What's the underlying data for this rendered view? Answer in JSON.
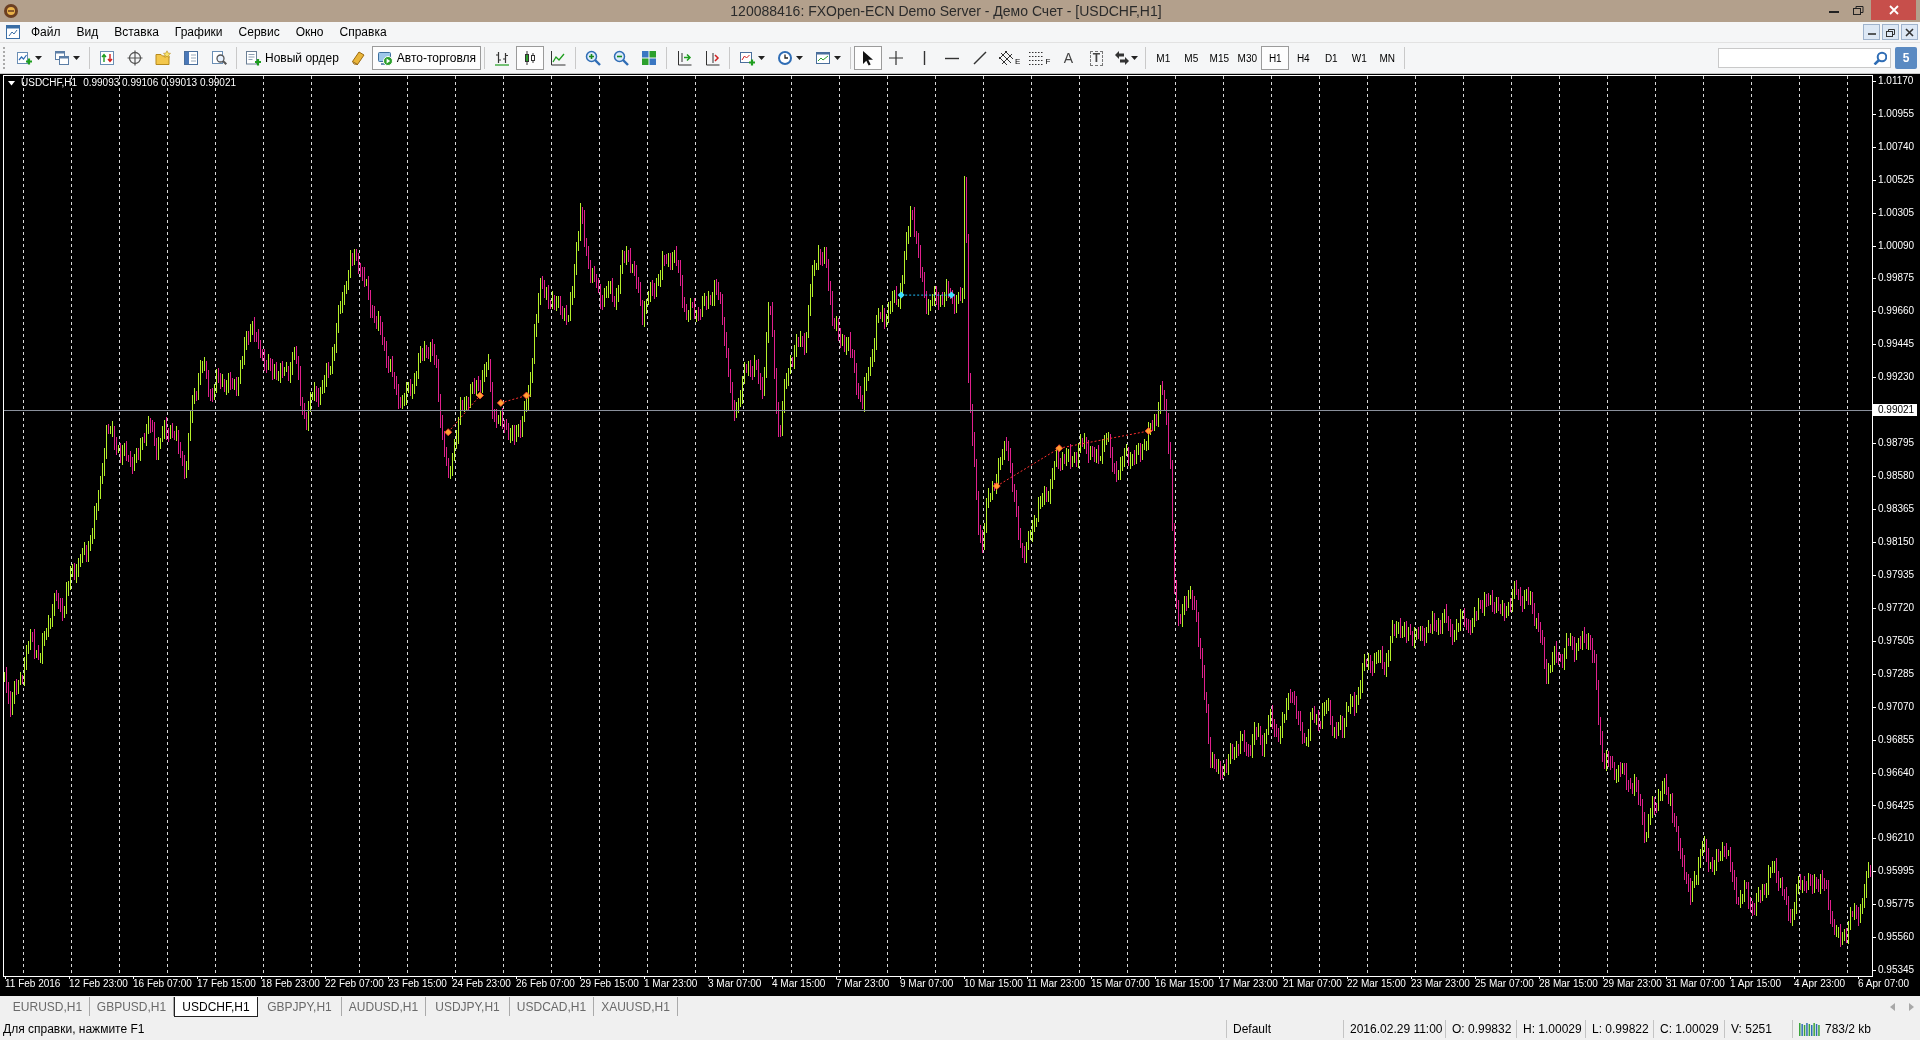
{
  "window": {
    "title": "120088416: FXOpen-ECN Demo Server - Демо Счет - [USDCHF,H1]"
  },
  "menu": [
    "Файл",
    "Вид",
    "Вставка",
    "Графики",
    "Сервис",
    "Окно",
    "Справка"
  ],
  "toolbar": {
    "new_order": "Новый ордер",
    "autotrading": {
      "label": "Авто-торговля",
      "on": true
    },
    "chart_types": [
      {
        "kind": "bars",
        "selected": false
      },
      {
        "kind": "candles",
        "selected": true
      },
      {
        "kind": "line",
        "selected": false
      }
    ],
    "tools": [
      {
        "kind": "cursor",
        "selected": true
      },
      {
        "kind": "crosshair",
        "selected": false
      },
      {
        "kind": "vline",
        "selected": false
      },
      {
        "kind": "hline",
        "selected": false
      },
      {
        "kind": "trendline",
        "selected": false
      },
      {
        "kind": "channel",
        "selected": false,
        "label": "E"
      },
      {
        "kind": "fibo",
        "selected": false,
        "label": "F"
      },
      {
        "kind": "text",
        "selected": false,
        "label": "A"
      },
      {
        "kind": "textlabel",
        "selected": false,
        "label": "T"
      },
      {
        "kind": "arrows",
        "selected": false
      }
    ],
    "timeframes": [
      {
        "label": "M1",
        "selected": false
      },
      {
        "label": "M5",
        "selected": false
      },
      {
        "label": "M15",
        "selected": false
      },
      {
        "label": "M30",
        "selected": false
      },
      {
        "label": "H1",
        "selected": true
      },
      {
        "label": "H4",
        "selected": false
      },
      {
        "label": "D1",
        "selected": false
      },
      {
        "label": "W1",
        "selected": false
      },
      {
        "label": "MN",
        "selected": false
      }
    ],
    "messages": "5"
  },
  "chart": {
    "symbol": "USDCHF,H1",
    "ohlc": "0.99093 0.99106 0.99013 0.99021",
    "price_axis": [
      {
        "kind": "tick",
        "label": "1.01170"
      },
      {
        "kind": "tick",
        "label": "1.00955"
      },
      {
        "kind": "tick",
        "label": "1.00740"
      },
      {
        "kind": "tick",
        "label": "1.00525"
      },
      {
        "kind": "tick",
        "label": "1.00305"
      },
      {
        "kind": "tick",
        "label": "1.00090"
      },
      {
        "kind": "tick",
        "label": "0.99875"
      },
      {
        "kind": "tick",
        "label": "0.99660"
      },
      {
        "kind": "tick",
        "label": "0.99445"
      },
      {
        "kind": "tick",
        "label": "0.99230"
      },
      {
        "kind": "current",
        "label": "0.99021"
      },
      {
        "kind": "tick",
        "label": "0.98795"
      },
      {
        "kind": "tick",
        "label": "0.98580"
      },
      {
        "kind": "tick",
        "label": "0.98365"
      },
      {
        "kind": "tick",
        "label": "0.98150"
      },
      {
        "kind": "tick",
        "label": "0.97935"
      },
      {
        "kind": "tick",
        "label": "0.97720"
      },
      {
        "kind": "tick",
        "label": "0.97505"
      },
      {
        "kind": "tick",
        "label": "0.97285"
      },
      {
        "kind": "tick",
        "label": "0.97070"
      },
      {
        "kind": "tick",
        "label": "0.96855"
      },
      {
        "kind": "tick",
        "label": "0.96640"
      },
      {
        "kind": "tick",
        "label": "0.96425"
      },
      {
        "kind": "tick",
        "label": "0.96210"
      },
      {
        "kind": "tick",
        "label": "0.95995"
      },
      {
        "kind": "tick",
        "label": "0.95775"
      },
      {
        "kind": "tick",
        "label": "0.95560"
      },
      {
        "kind": "tick",
        "label": "0.95345"
      }
    ],
    "time_axis": [
      "11 Feb 2016",
      "12 Feb 23:00",
      "16 Feb 07:00",
      "17 Feb 15:00",
      "18 Feb 23:00",
      "22 Feb 07:00",
      "23 Feb 15:00",
      "24 Feb 23:00",
      "26 Feb 07:00",
      "29 Feb 15:00",
      "1 Mar 23:00",
      "3 Mar 07:00",
      "4 Mar 15:00",
      "7 Mar 23:00",
      "9 Mar 07:00",
      "10 Mar 15:00",
      "11 Mar 23:00",
      "15 Mar 07:00",
      "16 Mar 15:00",
      "17 Mar 23:00",
      "21 Mar 07:00",
      "22 Mar 15:00",
      "23 Mar 23:00",
      "25 Mar 07:00",
      "28 Mar 15:00",
      "29 Mar 23:00",
      "31 Mar 07:00",
      "1 Apr 15:00",
      "4 Apr 23:00",
      "6 Apr 07:00"
    ]
  },
  "tabs": [
    {
      "label": "EURUSD,H1",
      "selected": false
    },
    {
      "label": "GBPUSD,H1",
      "selected": false
    },
    {
      "label": "USDCHF,H1",
      "selected": true
    },
    {
      "label": "GBPJPY,H1",
      "selected": false
    },
    {
      "label": "AUDUSD,H1",
      "selected": false
    },
    {
      "label": "USDJPY,H1",
      "selected": false
    },
    {
      "label": "USDCAD,H1",
      "selected": false
    },
    {
      "label": "XAUUSD,H1",
      "selected": false
    }
  ],
  "status_bar": {
    "help": "Для справки, нажмите F1",
    "profile": "Default",
    "time": "2016.02.29 11:00",
    "open": "O: 0.99832",
    "high": "H: 1.00029",
    "low": "L: 0.99822",
    "close": "C: 1.00029",
    "volume": "V: 5251",
    "traffic": "783/2 kb"
  }
}
